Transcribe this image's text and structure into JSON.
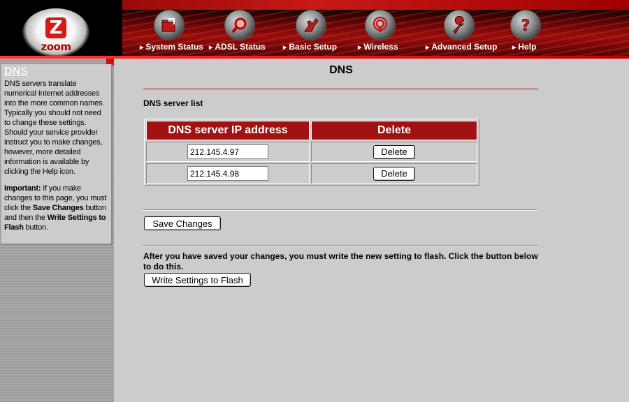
{
  "header": {
    "logo_letter": "Z",
    "logo_text": "zoom",
    "nav": [
      {
        "label": "System Status",
        "icon": "folder-icon"
      },
      {
        "label": "ADSL Status",
        "icon": "magnifier-icon"
      },
      {
        "label": "Basic Setup",
        "icon": "hand-icon"
      },
      {
        "label": "Wireless",
        "icon": "antenna-icon"
      },
      {
        "label": "Advanced Setup",
        "icon": "wrench-icon"
      },
      {
        "label": "Help",
        "icon": "question-icon"
      }
    ]
  },
  "sidebar": {
    "title": "DNS",
    "description": "DNS servers translate numerical Internet addresses into the more common names. Typically you should not need to change these settings. Should your service provider instruct you to make changes, however, more detailed information is available by clicking the Help icon.",
    "important_label": "Important:",
    "important_text_1": " If you make changes to this page, you must click the ",
    "important_save": "Save Changes",
    "important_text_2": " button and then the ",
    "important_flash": "Write Settings to Flash",
    "important_text_3": " button."
  },
  "main": {
    "title": "DNS",
    "section_label": "DNS server list",
    "table": {
      "headers": [
        "DNS server IP address",
        "Delete"
      ],
      "rows": [
        {
          "ip": "212.145.4.97",
          "delete_label": "Delete"
        },
        {
          "ip": "212.145.4.98",
          "delete_label": "Delete"
        }
      ]
    },
    "save_label": "Save Changes",
    "flash_note": "After you have saved your changes, you must write the new setting to flash. Click the button below to do this.",
    "flash_label": "Write Settings to Flash"
  }
}
